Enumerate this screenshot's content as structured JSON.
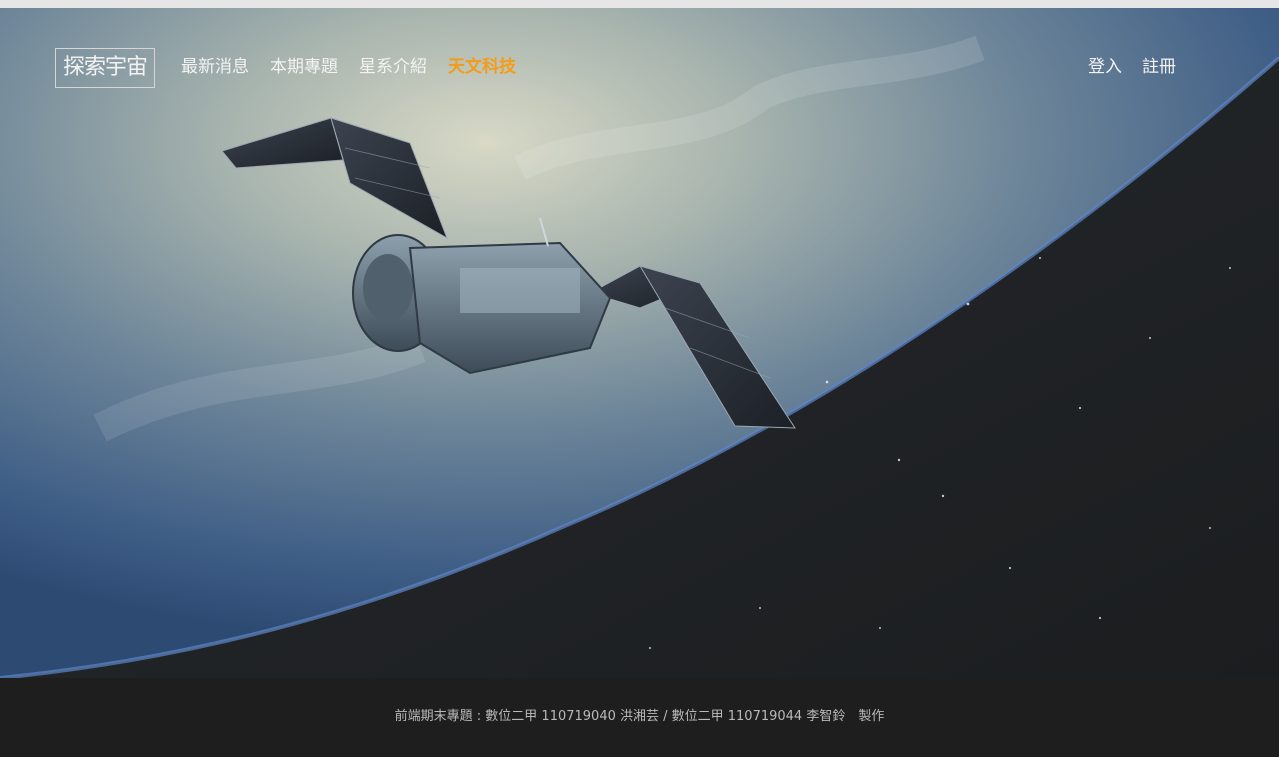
{
  "colors": {
    "accent": "#f39c1a",
    "nav_text": "#f3f3f3",
    "footer_bg": "#1e1e1e",
    "footer_text": "#b9b9b9"
  },
  "brand": {
    "logo_text": "探索宇宙"
  },
  "nav": {
    "items": [
      {
        "label": "最新消息"
      },
      {
        "label": "本期專題"
      },
      {
        "label": "星系介紹"
      },
      {
        "label": "天文科技"
      }
    ]
  },
  "auth": {
    "login": "登入",
    "register": "註冊"
  },
  "hero": {
    "image_desc": "satellite-over-earth"
  },
  "footer": {
    "credit": "前端期末專題 : 數位二甲 110719040 洪湘芸 / 數位二甲 110719044 李智鈴　製作"
  }
}
